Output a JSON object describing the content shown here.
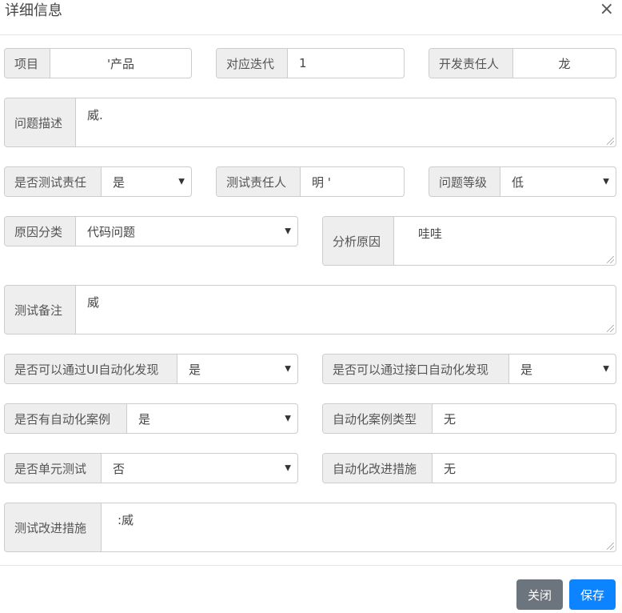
{
  "dialog": {
    "title": "详细信息",
    "close_symbol": "×"
  },
  "fields": {
    "project": {
      "label": "项目",
      "value": "'产品"
    },
    "iteration": {
      "label": "对应迭代",
      "value": "1"
    },
    "dev_owner": {
      "label": "开发责任人",
      "value": "龙"
    },
    "description": {
      "label": "问题描述",
      "value": "威."
    },
    "is_test_responsible": {
      "label": "是否测试责任",
      "value": "是"
    },
    "test_owner": {
      "label": "测试责任人",
      "value": "明 '"
    },
    "severity": {
      "label": "问题等级",
      "value": "低"
    },
    "cause_category": {
      "label": "原因分类",
      "value": "代码问题"
    },
    "analysis": {
      "label": "分析原因",
      "value": "哇哇"
    },
    "test_remark": {
      "label": "测试备注",
      "value": "威"
    },
    "ui_automation": {
      "label": "是否可以通过UI自动化发现",
      "value": "是"
    },
    "api_automation": {
      "label": "是否可以通过接口自动化发现",
      "value": "是"
    },
    "has_auto_case": {
      "label": "是否有自动化案例",
      "value": "是"
    },
    "auto_case_type": {
      "label": "自动化案例类型",
      "value": "无"
    },
    "unit_test": {
      "label": "是否单元测试",
      "value": "否"
    },
    "auto_improve": {
      "label": "自动化改进措施",
      "value": "无"
    },
    "test_improve": {
      "label": "测试改进措施",
      "value": ":威"
    }
  },
  "buttons": {
    "close": "关闭",
    "save": "保存"
  },
  "colors": {
    "save_button": "#0d84ff",
    "close_button": "#6c757d",
    "addon_background": "#eeeeee"
  }
}
